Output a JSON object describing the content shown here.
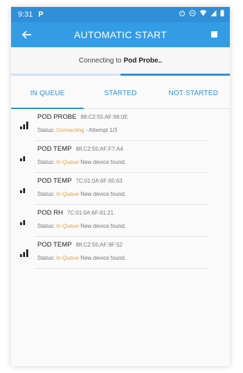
{
  "status_bar": {
    "time": "9:31",
    "app_icon": "P"
  },
  "app_bar": {
    "title": "AUTOMATIC START"
  },
  "connecting": {
    "prefix": "Connecting to",
    "device": "Pod Probe.."
  },
  "progress": {
    "fraction": 0.5
  },
  "tabs": [
    {
      "label": "IN QUEUE",
      "active": true
    },
    {
      "label": "STARTED",
      "active": false
    },
    {
      "label": "NOT STARTED",
      "active": false
    }
  ],
  "devices": [
    {
      "name": "POD PROBE",
      "mac": "88:C2:55:AF:96:0E",
      "status_label": "Status:",
      "status": "Connecting",
      "detail": " - Attempt 1/3",
      "signal": 3
    },
    {
      "name": "POD TEMP",
      "mac": "88:C2:55:AF:F7:A4",
      "status_label": "Status:",
      "status": "In Queue",
      "detail": " New device found.",
      "signal": 2
    },
    {
      "name": "POD TEMP",
      "mac": "7C:01:0A:6F:65:63",
      "status_label": "Status:",
      "status": "In Queue",
      "detail": " New device found.",
      "signal": 2
    },
    {
      "name": "POD RH",
      "mac": "7C:01:0A:6F:61:21",
      "status_label": "Status:",
      "status": "In Queue",
      "detail": " New device found.",
      "signal": 2
    },
    {
      "name": "POD TEMP",
      "mac": "88:C2:55:AF:9F:52",
      "status_label": "Status:",
      "status": "In Queue",
      "detail": " New device found.",
      "signal": 3
    }
  ],
  "colors": {
    "primary": "#349ce6",
    "status_accent": "#f0a030"
  }
}
